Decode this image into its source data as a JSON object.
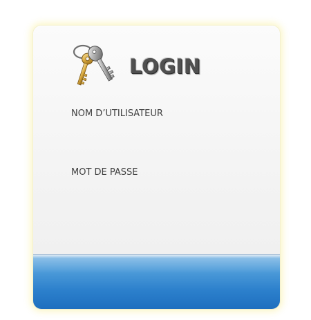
{
  "header": {
    "title": "LOGIN",
    "icon": "keys-icon"
  },
  "form": {
    "username_label": "NOM D’UTILISATEUR",
    "username_value": "",
    "password_label": "MOT DE PASSE",
    "password_value": ""
  },
  "colors": {
    "footer_blue": "#2c80cc",
    "card_glow": "#faf5be",
    "title_gray": "#505050"
  }
}
